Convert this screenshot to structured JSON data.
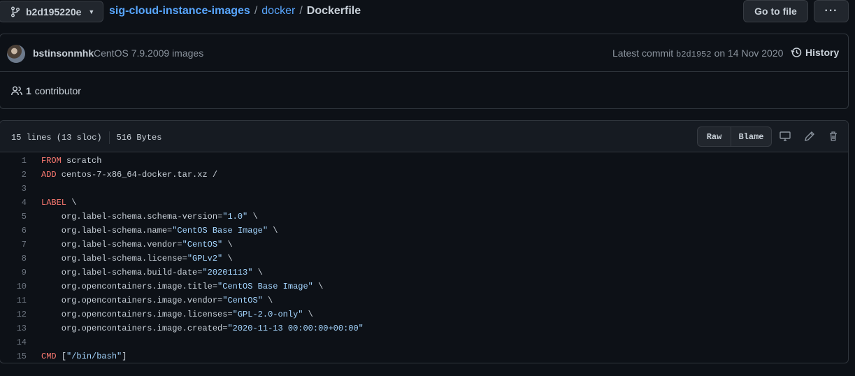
{
  "topbar": {
    "branch": "b2d195220e",
    "repo": "sig-cloud-instance-images",
    "sep": "/",
    "dir": "docker",
    "file": "Dockerfile",
    "goto_label": "Go to file",
    "more_label": "···"
  },
  "commit": {
    "author": "bstinsonmhk",
    "message": "CentOS 7.9.2009 images",
    "latest_label": "Latest commit",
    "sha": "b2d1952",
    "date": "on 14 Nov 2020",
    "history_label": "History"
  },
  "contributors": {
    "count": "1",
    "label": "contributor"
  },
  "file": {
    "lines_info": "15 lines (13 sloc)",
    "size": "516 Bytes",
    "raw_label": "Raw",
    "blame_label": "Blame"
  },
  "code_lines": [
    {
      "n": "1",
      "kw": "FROM",
      "rest": " scratch",
      "str": "",
      "tail": ""
    },
    {
      "n": "2",
      "kw": "ADD",
      "rest": " centos-7-x86_64-docker.tar.xz /",
      "str": "",
      "tail": ""
    },
    {
      "n": "3",
      "kw": "",
      "rest": "",
      "str": "",
      "tail": ""
    },
    {
      "n": "4",
      "kw": "LABEL",
      "rest": " \\",
      "str": "",
      "tail": ""
    },
    {
      "n": "5",
      "kw": "",
      "rest": "    org.label-schema.schema-version=",
      "str": "\"1.0\"",
      "tail": " \\"
    },
    {
      "n": "6",
      "kw": "",
      "rest": "    org.label-schema.name=",
      "str": "\"CentOS Base Image\"",
      "tail": " \\"
    },
    {
      "n": "7",
      "kw": "",
      "rest": "    org.label-schema.vendor=",
      "str": "\"CentOS\"",
      "tail": " \\"
    },
    {
      "n": "8",
      "kw": "",
      "rest": "    org.label-schema.license=",
      "str": "\"GPLv2\"",
      "tail": " \\"
    },
    {
      "n": "9",
      "kw": "",
      "rest": "    org.label-schema.build-date=",
      "str": "\"20201113\"",
      "tail": " \\"
    },
    {
      "n": "10",
      "kw": "",
      "rest": "    org.opencontainers.image.title=",
      "str": "\"CentOS Base Image\"",
      "tail": " \\"
    },
    {
      "n": "11",
      "kw": "",
      "rest": "    org.opencontainers.image.vendor=",
      "str": "\"CentOS\"",
      "tail": " \\"
    },
    {
      "n": "12",
      "kw": "",
      "rest": "    org.opencontainers.image.licenses=",
      "str": "\"GPL-2.0-only\"",
      "tail": " \\"
    },
    {
      "n": "13",
      "kw": "",
      "rest": "    org.opencontainers.image.created=",
      "str": "\"2020-11-13 00:00:00+00:00\"",
      "tail": ""
    },
    {
      "n": "14",
      "kw": "",
      "rest": "",
      "str": "",
      "tail": ""
    },
    {
      "n": "15",
      "kw": "CMD",
      "rest": " [",
      "str": "\"/bin/bash\"",
      "tail": "]"
    }
  ]
}
